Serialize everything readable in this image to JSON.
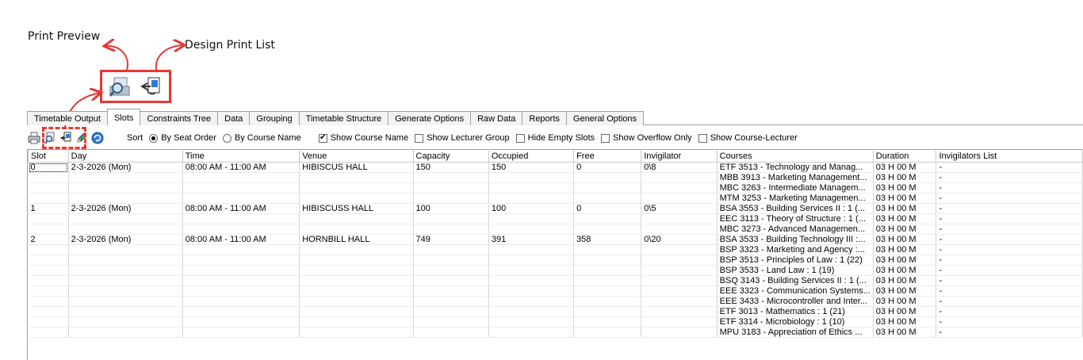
{
  "annotations": {
    "print_preview": "Print Preview",
    "design_print_list": "Design Print List"
  },
  "tabs": [
    "Timetable Output",
    "Slots",
    "Constraints Tree",
    "Data",
    "Grouping",
    "Timetable Structure",
    "Generate Options",
    "Raw Data",
    "Reports",
    "General Options"
  ],
  "active_tab": "Slots",
  "toolbar": {
    "icons": [
      "print-icon",
      "print-preview-icon",
      "design-print-list-icon",
      "edit-pencil-icon",
      "refresh-icon"
    ],
    "sort_label": "Sort",
    "sort_by_seat_order": "By Seat Order",
    "sort_by_course_name": "By Course Name",
    "show_course_name": "Show Course Name",
    "show_lecturer_group": "Show Lecturer Group",
    "hide_empty_slots": "Hide Empty Slots",
    "show_overflow_only": "Show Overflow Only",
    "show_course_lecturer": "Show Course-Lecturer",
    "checked": {
      "sort_by_seat_order": true,
      "show_course_name": true,
      "show_lecturer_group": false,
      "hide_empty_slots": false,
      "show_overflow_only": false,
      "show_course_lecturer": false
    }
  },
  "table": {
    "columns": [
      "Slot",
      "Day",
      "Time",
      "Venue",
      "Capacity",
      "Occupied",
      "Free",
      "Invigilator",
      "Courses",
      "Duration",
      "Invigilators List"
    ],
    "rows": [
      [
        "0",
        "2-3-2026 (Mon)",
        "08:00 AM - 11:00 AM",
        "HIBISCUS HALL",
        "150",
        "150",
        "0",
        "0\\8",
        "ETF 3513 - Technology and Manag...",
        "03 H 00 M",
        "-"
      ],
      [
        "",
        "",
        "",
        "",
        "",
        "",
        "",
        "",
        "MBB 3913 - Marketing Management...",
        "03 H 00 M",
        "-"
      ],
      [
        "",
        "",
        "",
        "",
        "",
        "",
        "",
        "",
        "MBC 3263 - Intermediate Managem...",
        "03 H 00 M",
        "-"
      ],
      [
        "",
        "",
        "",
        "",
        "",
        "",
        "",
        "",
        "MTM 3253 - Marketing Managemen...",
        "03 H 00 M",
        "-"
      ],
      [
        "1",
        "2-3-2026 (Mon)",
        "08:00 AM - 11:00 AM",
        "HIBISCUSS HALL",
        "100",
        "100",
        "0",
        "0\\5",
        "BSA 3553 - Building Services II : 1 (...",
        "03 H 00 M",
        "-"
      ],
      [
        "",
        "",
        "",
        "",
        "",
        "",
        "",
        "",
        "EEC 3113 - Theory of Structure : 1 (...",
        "03 H 00 M",
        "-"
      ],
      [
        "",
        "",
        "",
        "",
        "",
        "",
        "",
        "",
        "MBC 3273 - Advanced Managemen...",
        "03 H 00 M",
        "-"
      ],
      [
        "2",
        "2-3-2026 (Mon)",
        "08:00 AM - 11:00 AM",
        "HORNBILL HALL",
        "749",
        "391",
        "358",
        "0\\20",
        "BSA 3533 - Building Technology III :...",
        "03 H 00 M",
        "-"
      ],
      [
        "",
        "",
        "",
        "",
        "",
        "",
        "",
        "",
        "BSP 3323 - Marketing and Agency :...",
        "03 H 00 M",
        "-"
      ],
      [
        "",
        "",
        "",
        "",
        "",
        "",
        "",
        "",
        "BSP 3513 - Principles of Law : 1 (22)",
        "03 H 00 M",
        "-"
      ],
      [
        "",
        "",
        "",
        "",
        "",
        "",
        "",
        "",
        "BSP 3533 - Land Law : 1 (19)",
        "03 H 00 M",
        "-"
      ],
      [
        "",
        "",
        "",
        "",
        "",
        "",
        "",
        "",
        "BSQ 3143 - Building Services II : 1 (...",
        "03 H 00 M",
        "-"
      ],
      [
        "",
        "",
        "",
        "",
        "",
        "",
        "",
        "",
        "EEE 3323 - Communication Systems...",
        "03 H 00 M",
        "-"
      ],
      [
        "",
        "",
        "",
        "",
        "",
        "",
        "",
        "",
        "EEE 3433 - Microcontroller and Inter...",
        "03 H 00 M",
        "-"
      ],
      [
        "",
        "",
        "",
        "",
        "",
        "",
        "",
        "",
        "ETF 3013 - Mathematics : 1 (21)",
        "03 H 00 M",
        "-"
      ],
      [
        "",
        "",
        "",
        "",
        "",
        "",
        "",
        "",
        "ETF 3314 - Microbiology : 1 (10)",
        "03 H 00 M",
        "-"
      ],
      [
        "",
        "",
        "",
        "",
        "",
        "",
        "",
        "",
        "MPU 3183 - Appreciation of Ethics ...",
        "03 H 00 M",
        "-"
      ]
    ]
  },
  "colors": {
    "highlight": "#e53935",
    "grid_line": "#c8c8c8"
  }
}
